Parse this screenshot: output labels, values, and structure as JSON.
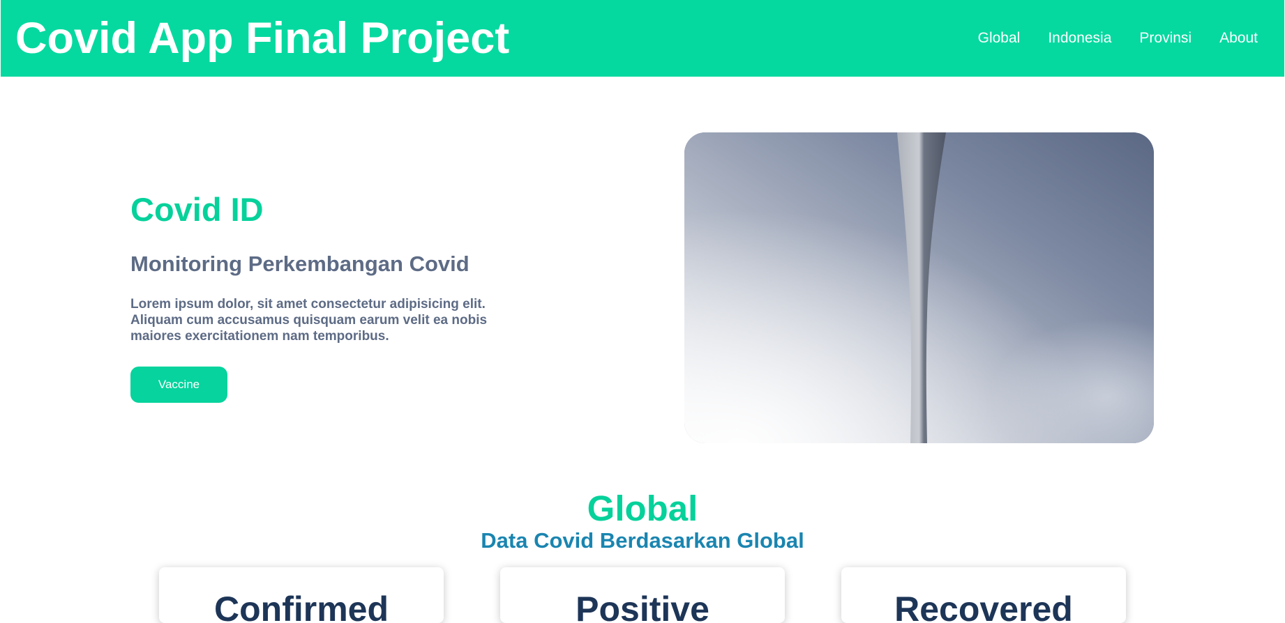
{
  "header": {
    "title": "Covid App Final Project",
    "nav": [
      "Global",
      "Indonesia",
      "Provinsi",
      "About"
    ]
  },
  "hero": {
    "title": "Covid ID",
    "subtitle": "Monitoring Perkembangan Covid",
    "description": "Lorem ipsum dolor, sit amet consectetur adipisicing elit. Aliquam cum accusamus quisquam earum velit ea nobis maiores exercitationem nam temporibus.",
    "button_label": "Vaccine",
    "image_icon": "sky-tower-photo"
  },
  "global": {
    "title": "Global",
    "subtitle": "Data Covid Berdasarkan Global",
    "cards": [
      {
        "title": "Confirmed"
      },
      {
        "title": "Positive"
      },
      {
        "title": "Recovered"
      }
    ]
  },
  "colors": {
    "accent": "#06d9a0",
    "text_muted": "#5d6b85",
    "subtitle_blue": "#1a85b0",
    "card_title": "#1d3557"
  }
}
